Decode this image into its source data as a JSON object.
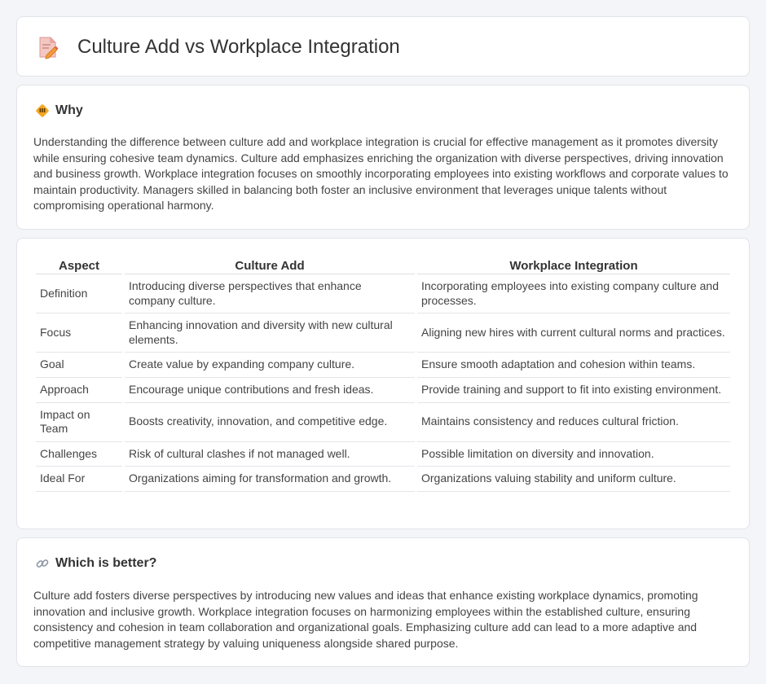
{
  "header": {
    "title": "Culture Add vs Workplace Integration",
    "icon": "document-pencil-icon"
  },
  "why": {
    "title": "Why",
    "icon": "diamond-sign-icon",
    "text": "Understanding the difference between culture add and workplace integration is crucial for effective management as it promotes diversity while ensuring cohesive team dynamics. Culture add emphasizes enriching the organization with diverse perspectives, driving innovation and business growth. Workplace integration focuses on smoothly incorporating employees into existing workflows and corporate values to maintain productivity. Managers skilled in balancing both foster an inclusive environment that leverages unique talents without compromising operational harmony."
  },
  "table": {
    "headers": [
      "Aspect",
      "Culture Add",
      "Workplace Integration"
    ],
    "rows": [
      [
        "Definition",
        "Introducing diverse perspectives that enhance company culture.",
        "Incorporating employees into existing company culture and processes."
      ],
      [
        "Focus",
        "Enhancing innovation and diversity with new cultural elements.",
        "Aligning new hires with current cultural norms and practices."
      ],
      [
        "Goal",
        "Create value by expanding company culture.",
        "Ensure smooth adaptation and cohesion within teams."
      ],
      [
        "Approach",
        "Encourage unique contributions and fresh ideas.",
        "Provide training and support to fit into existing environment."
      ],
      [
        "Impact on Team",
        "Boosts creativity, innovation, and competitive edge.",
        "Maintains consistency and reduces cultural friction."
      ],
      [
        "Challenges",
        "Risk of cultural clashes if not managed well.",
        "Possible limitation on diversity and innovation."
      ],
      [
        "Ideal For",
        "Organizations aiming for transformation and growth.",
        "Organizations valuing stability and uniform culture."
      ]
    ]
  },
  "better": {
    "title": "Which is better?",
    "icon": "link-icon",
    "text": "Culture add fosters diverse perspectives by introducing new values and ideas that enhance existing workplace dynamics, promoting innovation and inclusive growth. Workplace integration focuses on harmonizing employees within the established culture, ensuring consistency and cohesion in team collaboration and organizational goals. Emphasizing culture add can lead to a more adaptive and competitive management strategy by valuing uniqueness alongside shared purpose."
  }
}
